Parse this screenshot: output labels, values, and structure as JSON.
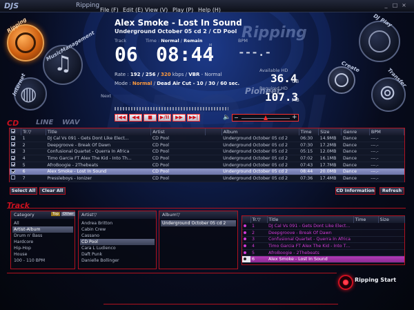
{
  "app": {
    "logo": "DJS",
    "mode_title": "Ripping",
    "menu": [
      "File (F)",
      "Edit (E)",
      "View (V)",
      "Play (P)",
      "Help (H)"
    ],
    "window_buttons": [
      "_",
      "□",
      "×"
    ]
  },
  "nav": {
    "ripping": "Ripping",
    "music_management": "MusicManagement",
    "internet": "Internet",
    "dj_play": "DJ Play",
    "create": "Create",
    "transfer": "Transfer",
    "ripping_banner": "Ripping",
    "next": "Next"
  },
  "now_playing": {
    "title": "Alex Smoke - Lost In Sound",
    "album_line": "Underground October 05 cd 2 / CD Pool",
    "track_label": "Track",
    "track_number": "06",
    "time_label": "Time : ",
    "time_mode_normal": "Normal",
    "time_mode_sep": " / ",
    "time_mode_remain": "Remain",
    "time_value": "08:44",
    "time_ms_top": "M",
    "time_ms_mid": "S",
    "time_ms_bot": "F",
    "bpm_label": "BPM",
    "bpm_value": "---.-",
    "rate_label": "Rate : ",
    "rate_values": "192 / 256 / ",
    "rate_hl": "320",
    "rate_unit": " kbps / ",
    "rate_vbr": "VBR",
    "rate_suffix": " - Normal",
    "mode_label": "Mode : ",
    "mode_normal": "Normal",
    "mode_sep": " / ",
    "mode_deadair": "Dead Air Cut",
    "mode_secs": " - 10 / 30 / 60 sec.",
    "available_label": "Available HD",
    "available_value": "36.4",
    "available_unit": "GB",
    "required_label": "Required HD",
    "required_value": "107.3",
    "required_unit": "MB",
    "brand": "Pioneer"
  },
  "transport": [
    "|◀◀",
    "◀◀",
    "■",
    "▶/II",
    "▶▶",
    "▶▶|"
  ],
  "volume": {
    "minus": "−",
    "plus": "+",
    "icon": "speaker-icon"
  },
  "section_cd": "CD",
  "section_line": "LINE",
  "section_wav": "WAV",
  "cd_table": {
    "headers": [
      "",
      "Tr.▽",
      "Title",
      "Artist",
      "Album",
      "Time",
      "Size",
      "Genre",
      "BPM"
    ],
    "rows": [
      {
        "checked": true,
        "tr": "1",
        "title": "DJ Cal Vs 091 - Gets Dont Like Elect...",
        "artist": "CD Pool",
        "album": "Underground October 05 cd 2",
        "time": "06:30",
        "size": "14.9MB",
        "genre": "Dance",
        "bpm": "---.-"
      },
      {
        "checked": true,
        "tr": "2",
        "title": "Deepgroove - Break Of Dawn",
        "artist": "CD Pool",
        "album": "Underground October 05 cd 2",
        "time": "07:30",
        "size": "17.2MB",
        "genre": "Dance",
        "bpm": "---.-"
      },
      {
        "checked": true,
        "tr": "3",
        "title": "Confusional Quartet - Querra In Africa",
        "artist": "CD Pool",
        "album": "Underground October 05 cd 2",
        "time": "05:15",
        "size": "12.0MB",
        "genre": "Dance",
        "bpm": "---.-"
      },
      {
        "checked": true,
        "tr": "4",
        "title": "Timo Garcia FT Alex The Kid - Into Th...",
        "artist": "CD Pool",
        "album": "Underground October 05 cd 2",
        "time": "07:02",
        "size": "16.1MB",
        "genre": "Dance",
        "bpm": "---.-"
      },
      {
        "checked": true,
        "tr": "5",
        "title": "AfroBoogie - 2Thebeats",
        "artist": "CD Pool",
        "album": "Underground October 05 cd 2",
        "time": "07:43",
        "size": "17.7MB",
        "genre": "Dance",
        "bpm": "---.-"
      },
      {
        "checked": true,
        "tr": "6",
        "title": "Alex Smoke - Lost In Sound",
        "artist": "CD Pool",
        "album": "Underground October 05 cd 2",
        "time": "08:44",
        "size": "20.0MB",
        "genre": "Dance",
        "bpm": "---.-",
        "selected": true
      },
      {
        "checked": false,
        "tr": "7",
        "title": "Pressleboys - Ionizer",
        "artist": "CD Pool",
        "album": "Underground October 05 cd 2",
        "time": "07:36",
        "size": "17.4MB",
        "genre": "Dance",
        "bpm": "---.-"
      }
    ]
  },
  "buttons": {
    "select_all": "Select All",
    "clear_all": "Clear All",
    "cd_information": "CD Information",
    "refresh": "Refresh",
    "ripping_start": "Ripping Start"
  },
  "section_track": "Track",
  "category": {
    "header": "Category",
    "tag_top": "Top",
    "tag_other": "Other",
    "items": [
      "All",
      "Artist-Album",
      "Drum n' Bass",
      "Hardcore",
      "Hip-Hop",
      "House",
      "100 - 110 BPM"
    ],
    "selected_index": 1
  },
  "artist": {
    "header": "Artist▽",
    "items": [
      "Andrea Britton",
      "Cabin Crew",
      "Cassano",
      "CD Pool",
      "Cara L Ludienco",
      "Daft Punk",
      "Danielle Bollinger"
    ],
    "selected_index": 3
  },
  "album": {
    "header": "Album▽",
    "items": [
      "Underground October 05 cd 2"
    ],
    "selected_index": 0
  },
  "tracks": {
    "headers": [
      "",
      "Tr.▽",
      "Title",
      "Time",
      "Size"
    ],
    "rows": [
      {
        "tr": "1",
        "title": "DJ Cal Vs 091 - Gets Dont Like Elect..."
      },
      {
        "tr": "2",
        "title": "Deepgroove - Break Of Dawn"
      },
      {
        "tr": "3",
        "title": "Confusional Quartet - Querra In Africa"
      },
      {
        "tr": "4",
        "title": "Timo Garcia FT Alex The Kid - Into Th..."
      },
      {
        "tr": "5",
        "title": "AfroBoogie - 2Thebeats"
      },
      {
        "tr": "6",
        "title": "Alex Smoke - Lost In Sound",
        "selected": true
      }
    ]
  },
  "colors": {
    "accent_red": "#b2121f",
    "accent_orange": "#ff9a3c",
    "accent_magenta": "#d23ad6"
  }
}
